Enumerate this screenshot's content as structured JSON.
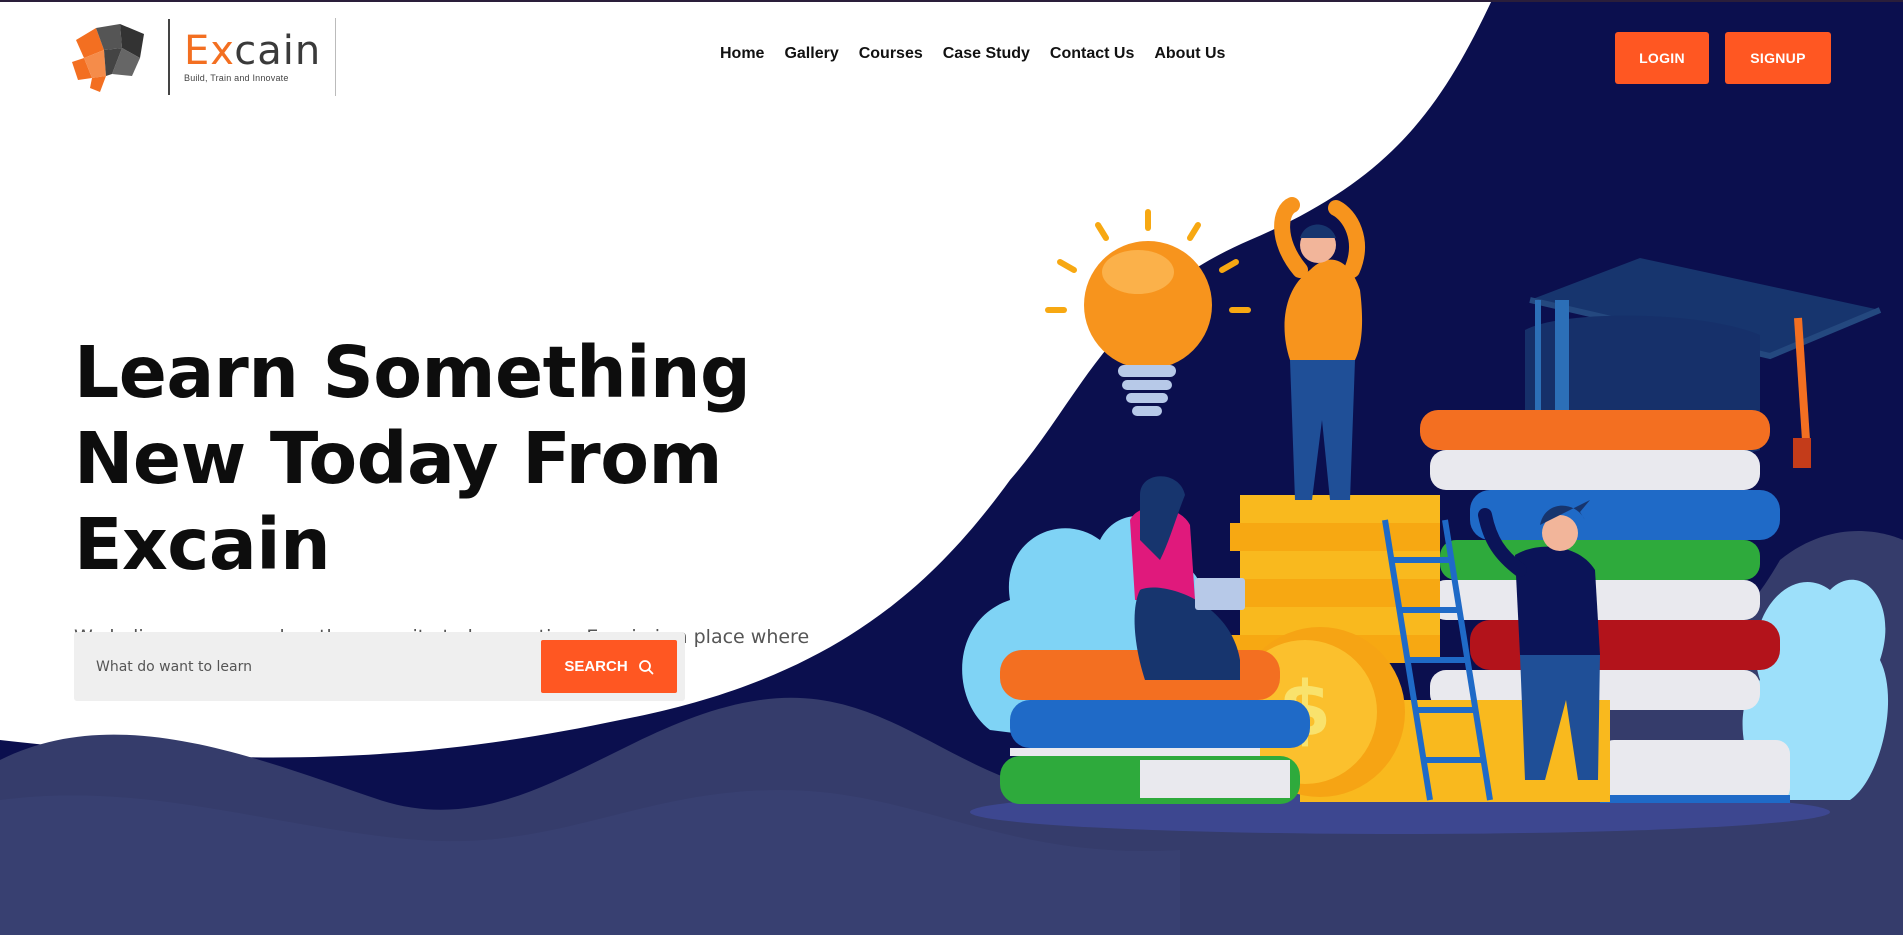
{
  "brand": {
    "name_accent": "Ex",
    "name_rest": "cain",
    "tagline": "Build, Train and Innovate",
    "accent_color": "#f36f21"
  },
  "nav": {
    "items": [
      {
        "label": "Home"
      },
      {
        "label": "Gallery"
      },
      {
        "label": "Courses"
      },
      {
        "label": "Case Study"
      },
      {
        "label": "Contact Us"
      },
      {
        "label": "About Us"
      }
    ]
  },
  "auth": {
    "login_label": "LOGIN",
    "signup_label": "SIGNUP"
  },
  "hero": {
    "title_line1": "Learn Something",
    "title_line2": "New Today From Excain",
    "subtitle": "We believe everyone has the capacity to be creative. Excain is a place where people develop their own potential."
  },
  "search": {
    "placeholder": "What do want to learn",
    "button_label": "SEARCH",
    "icon": "search-icon"
  },
  "colors": {
    "navy": "#0b0f4e",
    "wave": "#353c6b",
    "button": "#ff5722",
    "illustration_icons": [
      "lightbulb-icon",
      "graduation-cap-icon",
      "books-stack-icon",
      "coin-icon",
      "ladder-icon"
    ]
  }
}
